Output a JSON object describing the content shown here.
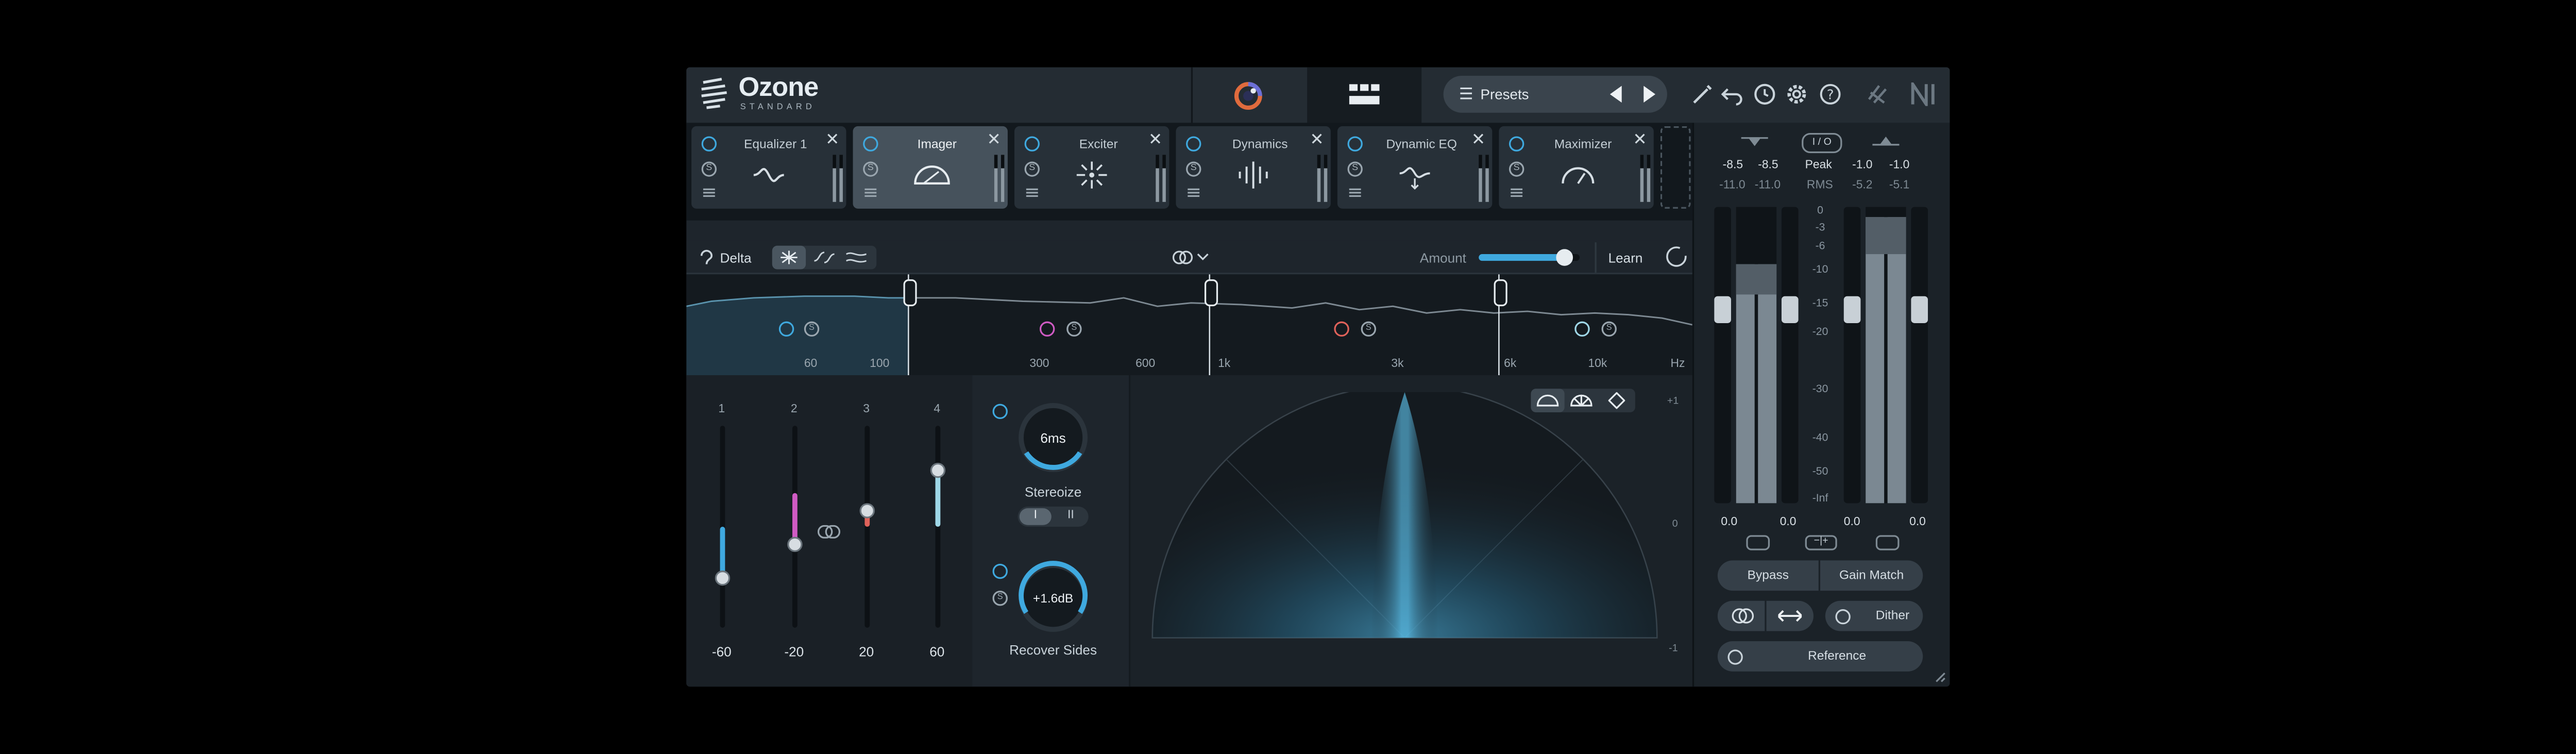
{
  "app": {
    "name": "Ozone",
    "edition": "STANDARD"
  },
  "header": {
    "presets_label": "Presets"
  },
  "modules": [
    {
      "name": "Equalizer 1",
      "icon": "eq-curve-icon"
    },
    {
      "name": "Imager",
      "icon": "stereo-arc-icon",
      "selected": true
    },
    {
      "name": "Exciter",
      "icon": "exciter-burst-icon"
    },
    {
      "name": "Dynamics",
      "icon": "dynamics-bars-icon"
    },
    {
      "name": "Dynamic EQ",
      "icon": "dynamic-eq-icon"
    },
    {
      "name": "Maximizer",
      "icon": "gauge-icon"
    }
  ],
  "toolbar": {
    "delta_label": "Delta",
    "amount_label": "Amount",
    "amount_value": 0.85,
    "learn_label": "Learn"
  },
  "spectrum": {
    "freq_labels": [
      "60",
      "100",
      "300",
      "600",
      "1k",
      "3k",
      "6k",
      "10k",
      "Hz"
    ]
  },
  "bands": [
    {
      "number": "1",
      "value": "-60",
      "width_level": 0.25,
      "color": "#3fa9df"
    },
    {
      "number": "2",
      "value": "-20",
      "width_level": 0.42,
      "color": "#d05bc4"
    },
    {
      "number": "3",
      "value": "20",
      "width_level": 0.58,
      "color": "#e0625a"
    },
    {
      "number": "4",
      "value": "60",
      "width_level": 0.78,
      "color": "#9fd7e7"
    }
  ],
  "stereoize": {
    "value": "6ms",
    "label": "Stereoize",
    "mode_1": "I",
    "mode_2": "II",
    "active_mode": "I"
  },
  "recover_sides": {
    "value": "+1.6dB",
    "label": "Recover Sides"
  },
  "vectorscope": {
    "scale_top": "+1",
    "scale_mid": "0",
    "scale_bottom": "-1"
  },
  "meters": {
    "io_label": "I / O",
    "in_peak": [
      "-8.5",
      "-8.5"
    ],
    "in_rms": [
      "-11.0",
      "-11.0"
    ],
    "out_peak": [
      "-1.0",
      "-1.0"
    ],
    "out_rms": [
      "-5.2",
      "-5.1"
    ],
    "peak_label": "Peak",
    "rms_label": "RMS",
    "scale": [
      "0",
      "-3",
      "-6",
      "-10",
      "-15",
      "-20",
      "-30",
      "-40",
      "-50",
      "-Inf"
    ],
    "gain_values": [
      "0.0",
      "0.0",
      "0.0",
      "0.0"
    ]
  },
  "footer": {
    "bypass_label": "Bypass",
    "gain_match_label": "Gain Match",
    "dither_label": "Dither",
    "reference_label": "Reference"
  }
}
